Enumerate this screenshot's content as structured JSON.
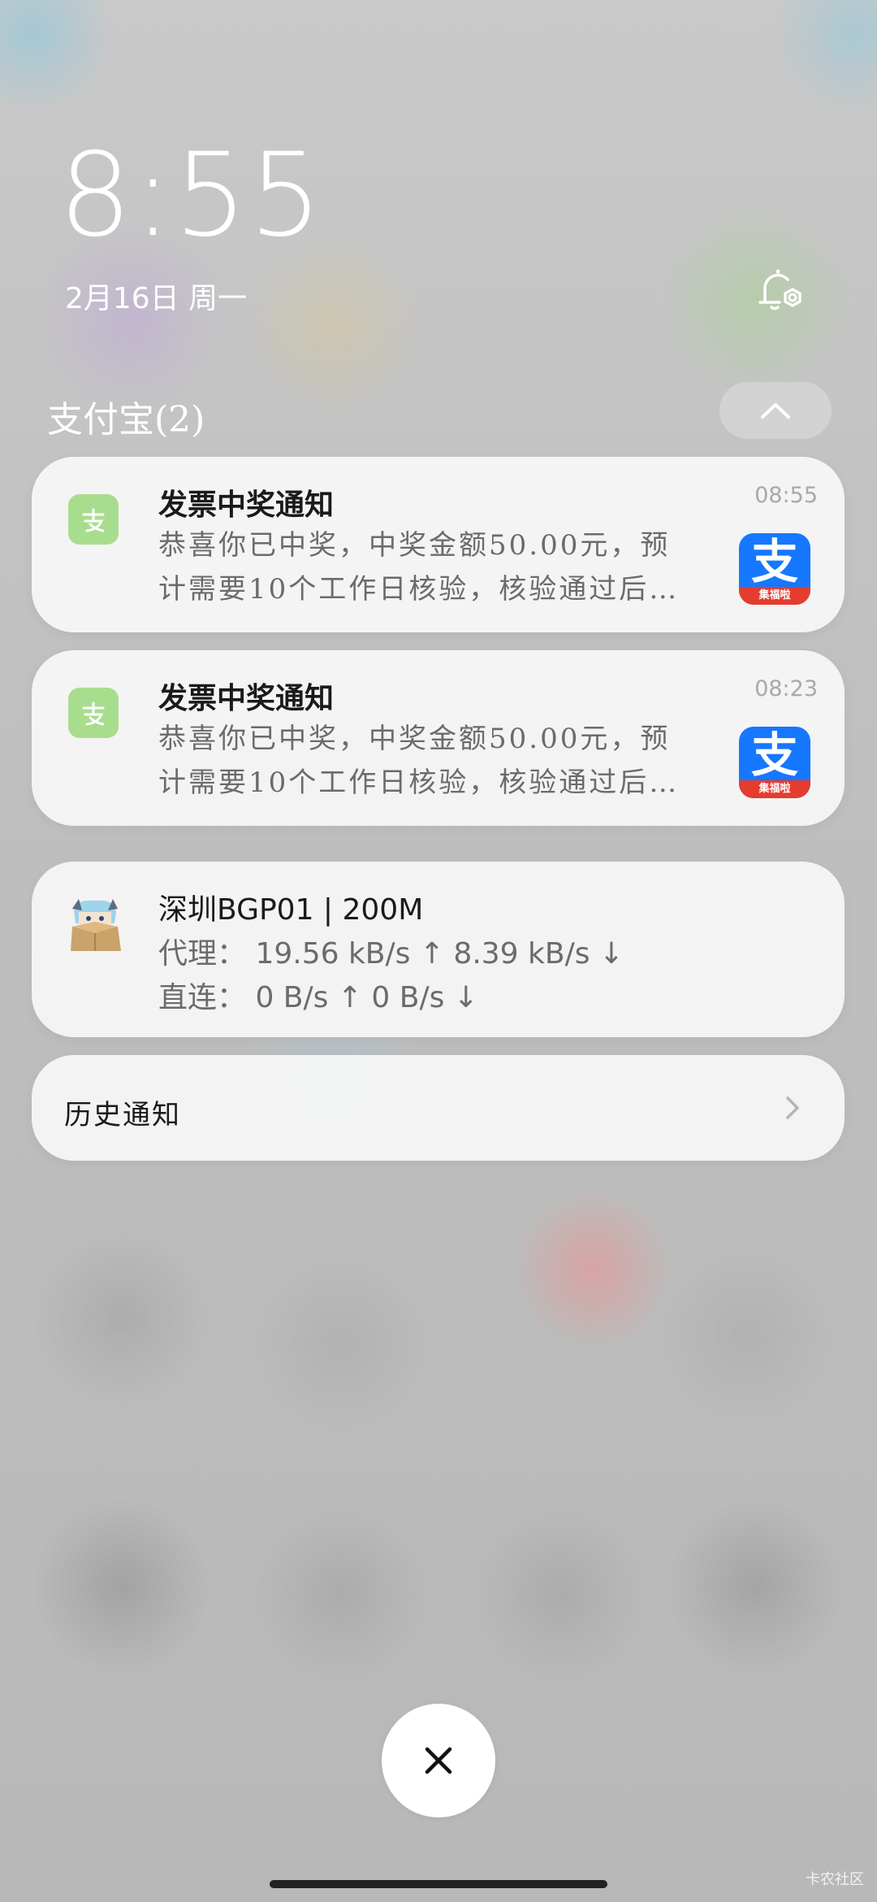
{
  "status": {
    "time": "8:55",
    "date": "2月16日 周一"
  },
  "group": {
    "title": "支付宝(2)"
  },
  "notifications": [
    {
      "app_icon_glyph": "支",
      "title": "发票中奖通知",
      "time": "08:55",
      "body_line1": "恭喜你已中奖，中奖金额50.00元，预",
      "body_line2": "计需要10个工作日核验，核验通过后",
      "big_icon_glyph": "支",
      "big_icon_band": "集福啦"
    },
    {
      "app_icon_glyph": "支",
      "title": "发票中奖通知",
      "time": "08:23",
      "body_line1": "恭喜你已中奖，中奖金额50.00元，预",
      "body_line2": "计需要10个工作日核验，核验通过后",
      "big_icon_glyph": "支",
      "big_icon_band": "集福啦"
    }
  ],
  "proxy": {
    "title": "深圳BGP01 | 200M",
    "line1": "代理：  19.56 kB/s ↑  8.39 kB/s ↓",
    "line2": "直连：  0 B/s ↑  0 B/s ↓"
  },
  "history": {
    "label": "历史通知"
  },
  "watermark": "卡农社区",
  "icons": {
    "bell_settings": "bell-settings-icon",
    "collapse": "chevron-up-icon",
    "history": "chevron-right-icon",
    "close": "close-icon"
  },
  "colors": {
    "alipay_blue": "#1677ff",
    "alipay_green_small": "#a8dd8e",
    "band_red": "#e53c2f"
  }
}
